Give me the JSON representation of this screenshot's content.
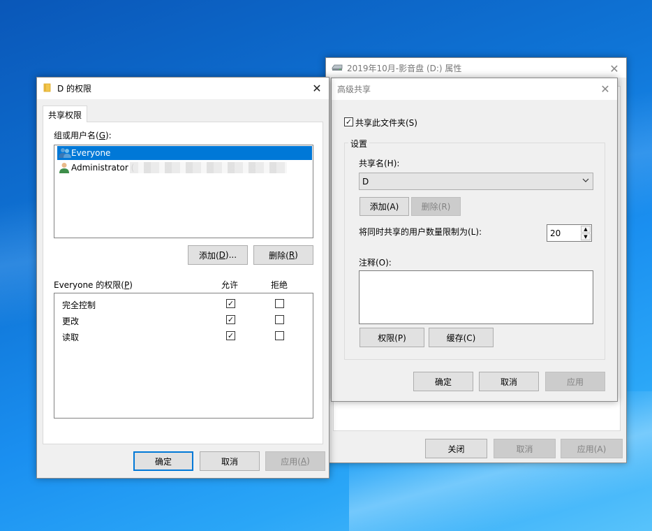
{
  "desktop": {},
  "prop_window": {
    "title": "2019年10月-影音盘 (D:) 属性",
    "buttons": {
      "close": "关闭",
      "cancel": "取消",
      "apply": "应用(A)"
    }
  },
  "adv_share": {
    "title": "高级共享",
    "share_checkbox": "共享此文件夹(S)",
    "settings_group": "设置",
    "share_name_label": "共享名(H):",
    "share_name_value": "D",
    "add_button": "添加(A)",
    "remove_button": "删除(R)",
    "user_limit_label": "将同时共享的用户数量限制为(L):",
    "user_limit_value": "20",
    "comment_label": "注释(O):",
    "permissions_button": "权限(P)",
    "cache_button": "缓存(C)",
    "ok_button": "确定",
    "cancel_button": "取消",
    "apply_button": "应用"
  },
  "perm_dialog": {
    "title": "D 的权限",
    "tab": "共享权限",
    "group_label": "组或用户名(",
    "group_label_key": "G",
    "group_label_end": "):",
    "users": [
      {
        "name": "Everyone",
        "selected": true
      },
      {
        "name": "Administrator (",
        "selected": false
      }
    ],
    "add_button": "添加(",
    "add_key": "D",
    "add_end": ")...",
    "remove_button": "删除(",
    "remove_key": "R",
    "remove_end": ")",
    "perm_label": "Everyone 的权限(",
    "perm_key": "P",
    "perm_end": ")",
    "allow_header": "允许",
    "deny_header": "拒绝",
    "permissions": [
      {
        "name": "完全控制",
        "allow": true,
        "deny": false
      },
      {
        "name": "更改",
        "allow": true,
        "deny": false
      },
      {
        "name": "读取",
        "allow": true,
        "deny": false
      }
    ],
    "ok_button": "确定",
    "cancel_button": "取消",
    "apply_button": "应用(",
    "apply_key": "A",
    "apply_end": ")"
  }
}
